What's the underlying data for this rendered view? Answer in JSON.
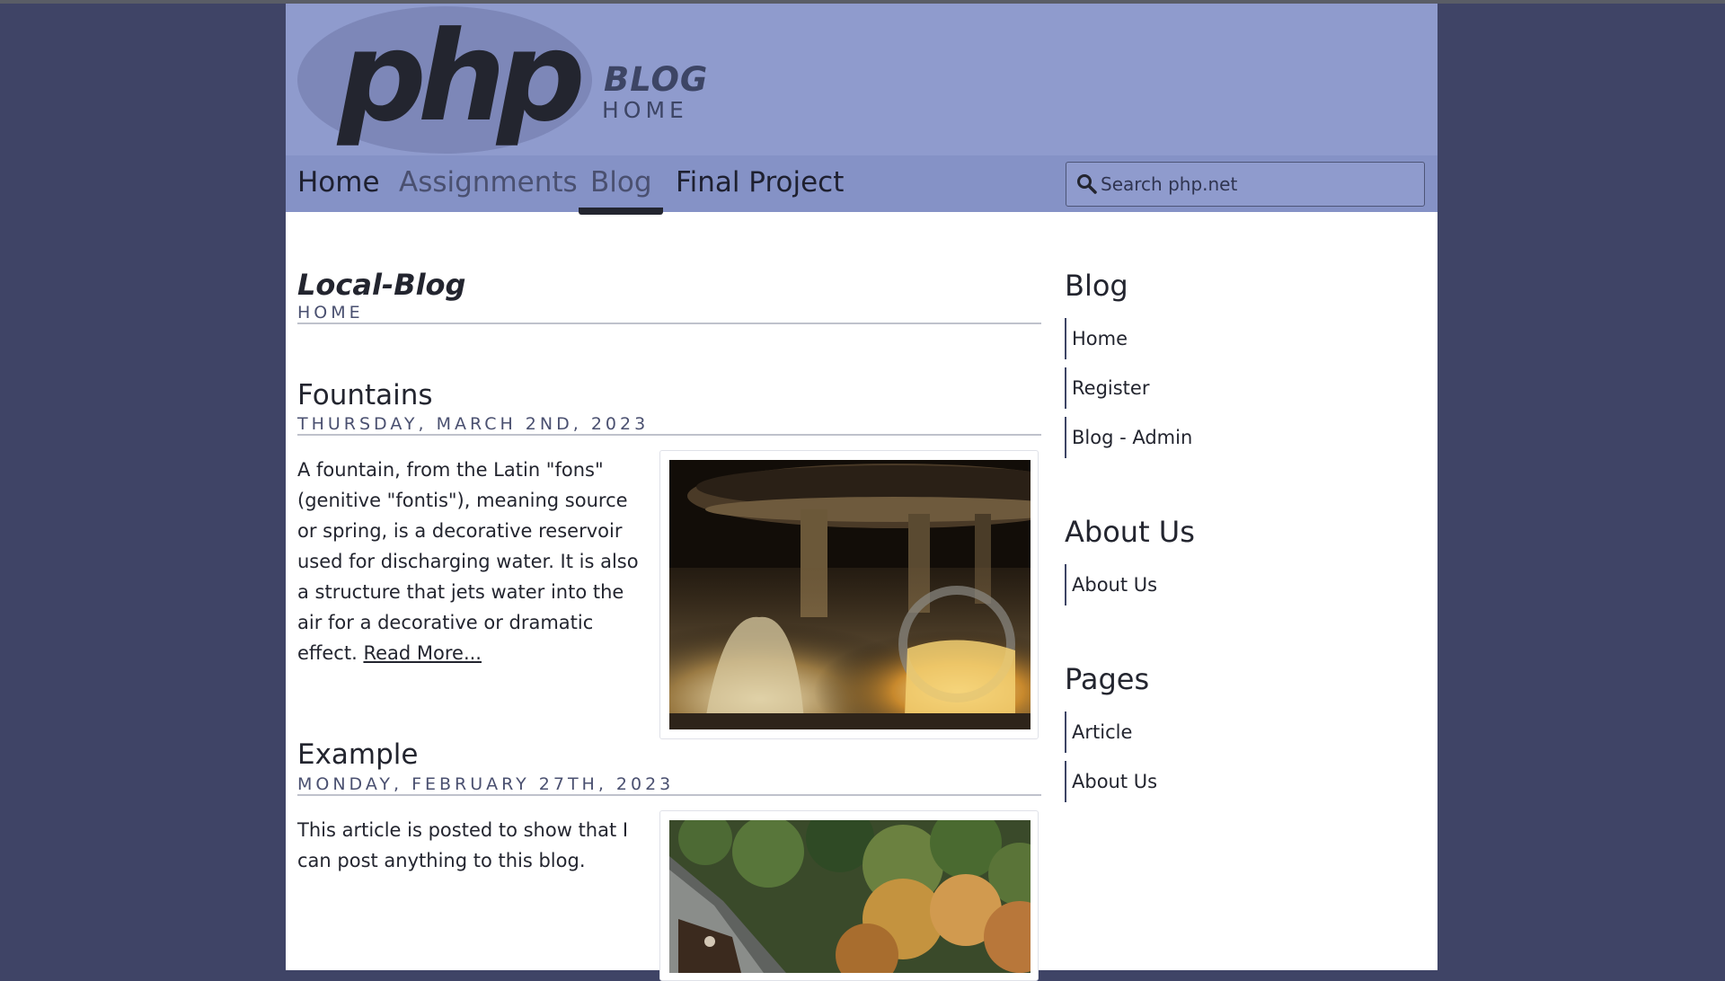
{
  "header": {
    "logo_text": "php",
    "logo_blog": "BLOG",
    "logo_home": "HOME"
  },
  "nav": {
    "items": [
      {
        "label": "Home",
        "active": false
      },
      {
        "label": "Assignments",
        "active": false
      },
      {
        "label": "Blog",
        "active": true
      },
      {
        "label": "Final Project",
        "active": false
      }
    ],
    "search_placeholder": "Search php.net"
  },
  "main": {
    "title": "Local-Blog",
    "subtitle": "HOME",
    "articles": [
      {
        "title": "Fountains",
        "date": "THURSDAY, MARCH 2ND, 2023",
        "text": "A fountain, from the Latin \"fons\" (genitive \"fontis\"), meaning source or spring, is a decorative reservoir used for discharging water. It is also a structure that jets water into the air for a decorative or dramatic effect.",
        "read_more": "Read More..."
      },
      {
        "title": "Example",
        "date": "MONDAY, FEBRUARY 27TH, 2023",
        "text": "This article is posted to show that I can post anything to this blog."
      }
    ]
  },
  "sidebar": {
    "sections": [
      {
        "heading": "Blog",
        "links": [
          "Home",
          "Register",
          "Blog - Admin"
        ]
      },
      {
        "heading": "About Us",
        "links": [
          "About Us"
        ]
      },
      {
        "heading": "Pages",
        "links": [
          "Article",
          "About Us"
        ]
      }
    ]
  },
  "colors": {
    "background": "#3f4466",
    "header": "#8f9bcd",
    "navbar": "#8592c6",
    "content": "#ffffff",
    "text": "#23252f"
  }
}
